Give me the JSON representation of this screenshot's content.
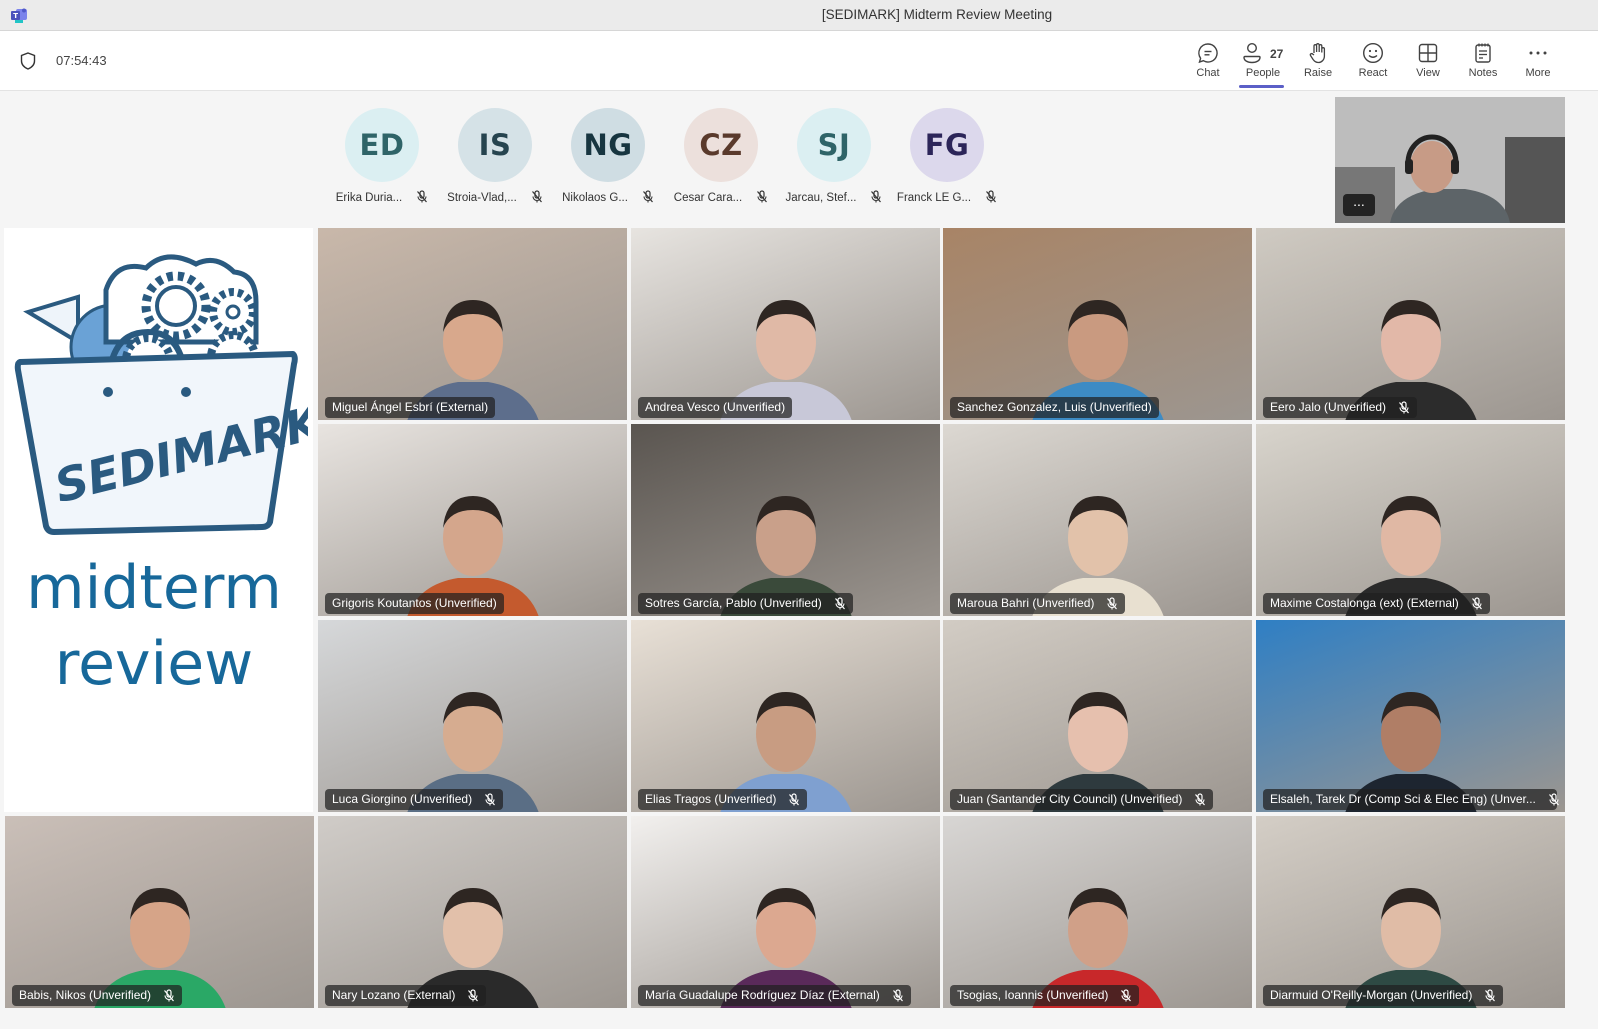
{
  "window": {
    "title": "[SEDIMARK] Midterm Review Meeting",
    "app_icon": "teams-icon"
  },
  "toolbar": {
    "timer": "07:54:43",
    "buttons": [
      {
        "id": "chat",
        "label": "Chat",
        "icon": "chat-icon"
      },
      {
        "id": "people",
        "label": "People",
        "icon": "people-icon",
        "count": "27",
        "active": true
      },
      {
        "id": "raise",
        "label": "Raise",
        "icon": "raise-hand-icon"
      },
      {
        "id": "react",
        "label": "React",
        "icon": "smiley-icon"
      },
      {
        "id": "view",
        "label": "View",
        "icon": "grid-view-icon"
      },
      {
        "id": "notes",
        "label": "Notes",
        "icon": "notes-icon"
      },
      {
        "id": "more",
        "label": "More",
        "icon": "more-icon"
      }
    ],
    "accent_color": "#5b5fc7"
  },
  "audio_only_participants": [
    {
      "initials": "ED",
      "name": "Erika Duria...",
      "muted": true,
      "bg": "#dbeff2",
      "fg": "#2f6468"
    },
    {
      "initials": "IS",
      "name": "Stroia-Vlad,...",
      "muted": true,
      "bg": "#d5e2e7",
      "fg": "#26444f"
    },
    {
      "initials": "NG",
      "name": "Nikolaos G...",
      "muted": true,
      "bg": "#cfdde3",
      "fg": "#173540"
    },
    {
      "initials": "CZ",
      "name": "Cesar Cara...",
      "muted": true,
      "bg": "#ece0dc",
      "fg": "#5a3a2c"
    },
    {
      "initials": "SJ",
      "name": "Jarcau, Stef...",
      "muted": true,
      "bg": "#dbeff2",
      "fg": "#2f6468"
    },
    {
      "initials": "FG",
      "name": "Franck LE G...",
      "muted": true,
      "bg": "#dcd8ec",
      "fg": "#2c2559"
    }
  ],
  "self_view": {
    "more_label": "..."
  },
  "shared_content": {
    "logo_text": "SEDIMARK",
    "line1": "midterm",
    "line2": "review",
    "color": "#17689a"
  },
  "video_tiles": [
    {
      "name": "Miguel Ángel Esbrí (External)",
      "muted": false
    },
    {
      "name": "Andrea Vesco (Unverified)",
      "muted": false
    },
    {
      "name": "Sanchez Gonzalez, Luis (Unverified)",
      "muted": false
    },
    {
      "name": "Eero Jalo (Unverified)",
      "muted": true
    },
    {
      "name": "Grigoris Koutantos (Unverified)",
      "muted": false
    },
    {
      "name": "Sotres García, Pablo (Unverified)",
      "muted": true
    },
    {
      "name": "Maroua Bahri (Unverified)",
      "muted": true
    },
    {
      "name": "Maxime Costalonga (ext) (External)",
      "muted": true
    },
    {
      "name": "Luca Giorgino (Unverified)",
      "muted": true
    },
    {
      "name": "Elias Tragos (Unverified)",
      "muted": true
    },
    {
      "name": "Juan (Santander City Council) (Unverified)",
      "muted": true
    },
    {
      "name": "Elsaleh, Tarek Dr (Comp Sci & Elec Eng) (Unver...",
      "muted": true
    },
    {
      "name": "Babis, Nikos (Unverified)",
      "muted": true
    },
    {
      "name": "Nary Lozano (External)",
      "muted": true
    },
    {
      "name": "María Guadalupe Rodríguez Díaz (External)",
      "muted": true
    },
    {
      "name": "Tsogias, Ioannis (Unverified)",
      "muted": true
    },
    {
      "name": "Diarmuid O'Reilly-Morgan (Unverified)",
      "muted": true
    }
  ]
}
